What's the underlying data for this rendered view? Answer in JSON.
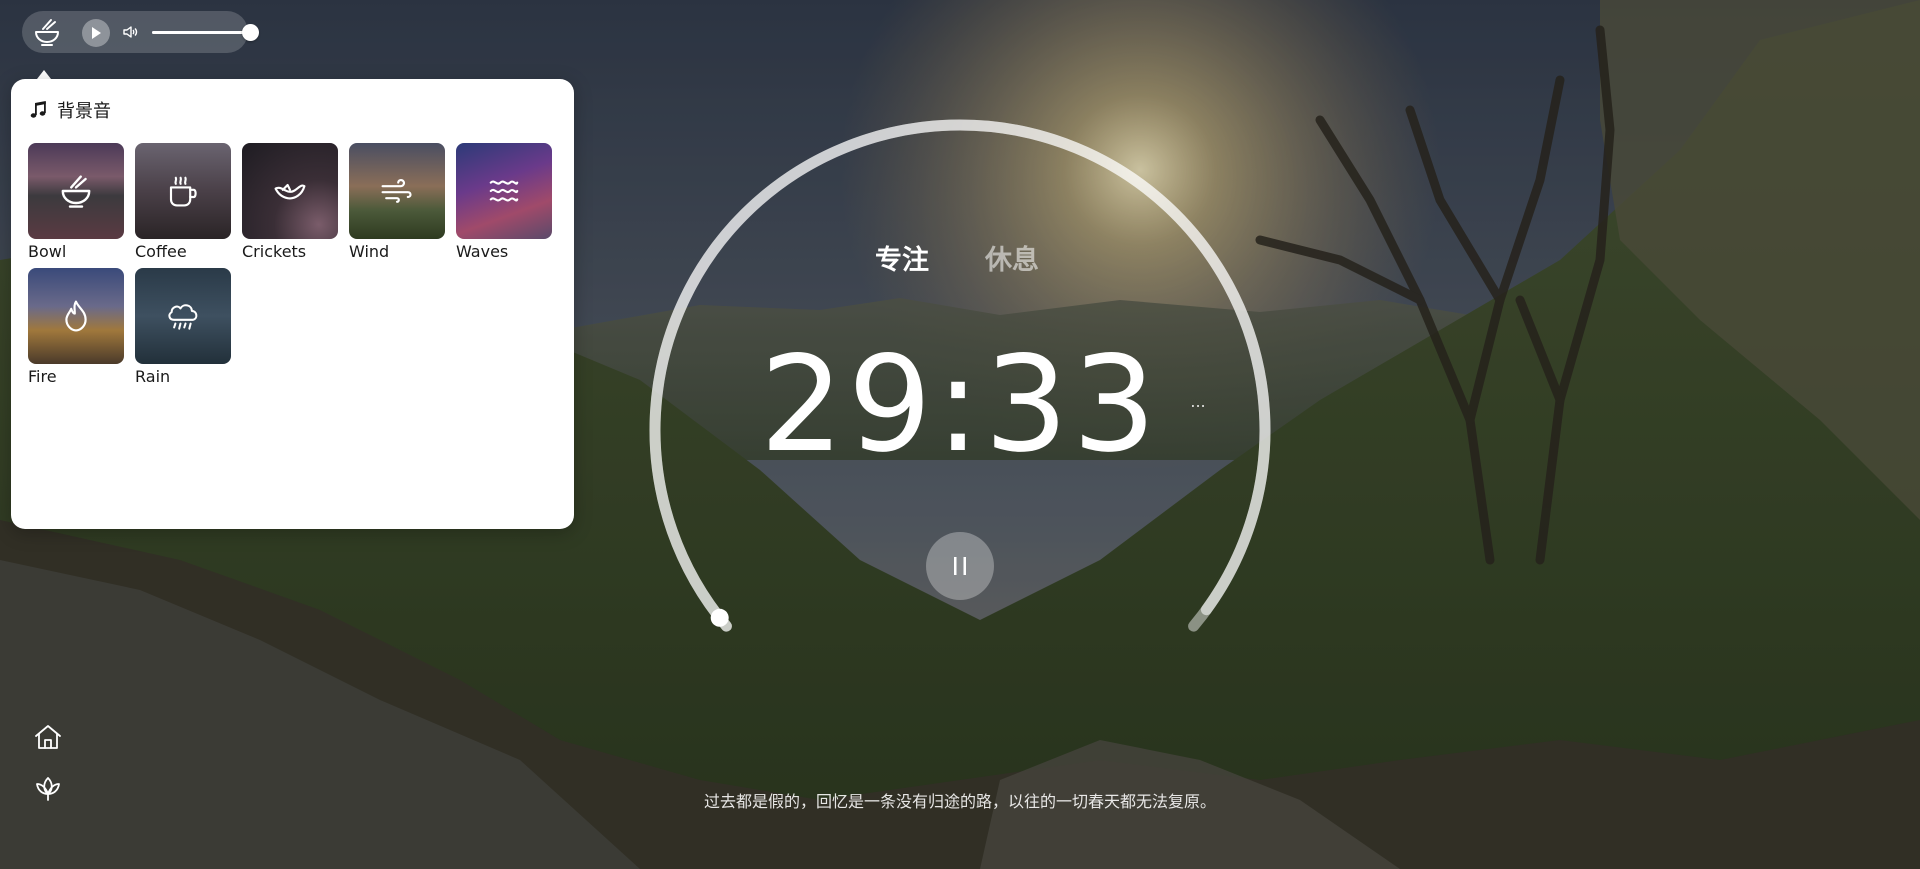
{
  "player": {
    "current_sound_icon": "bowl-icon",
    "play_icon": "play-icon",
    "volume_icon": "speaker-icon",
    "volume_level": 1.0
  },
  "sound_panel": {
    "title": "背景音",
    "title_icon": "music-note-icon",
    "items": [
      {
        "label": "Bowl",
        "icon": "bowl-icon"
      },
      {
        "label": "Coffee",
        "icon": "coffee-cup-icon"
      },
      {
        "label": "Crickets",
        "icon": "cricket-icon"
      },
      {
        "label": "Wind",
        "icon": "wind-icon"
      },
      {
        "label": "Waves",
        "icon": "waves-icon"
      },
      {
        "label": "Fire",
        "icon": "flame-icon"
      },
      {
        "label": "Rain",
        "icon": "rain-cloud-icon"
      }
    ]
  },
  "timer": {
    "tabs": [
      {
        "label": "专注",
        "active": true
      },
      {
        "label": "休息",
        "active": false
      }
    ],
    "time": "29:33",
    "more_label": "...",
    "progress_remaining": 0.985,
    "pause_icon": "pause-icon"
  },
  "nav": {
    "home_icon": "home-icon",
    "lotus_icon": "lotus-icon"
  },
  "quote": "过去都是假的，回忆是一条没有归途的路，以往的一切春天都无法复原。",
  "colors": {
    "panel_bg": "#ffffff",
    "text_dark": "#1a1a1a",
    "ring": "#ffffff"
  }
}
